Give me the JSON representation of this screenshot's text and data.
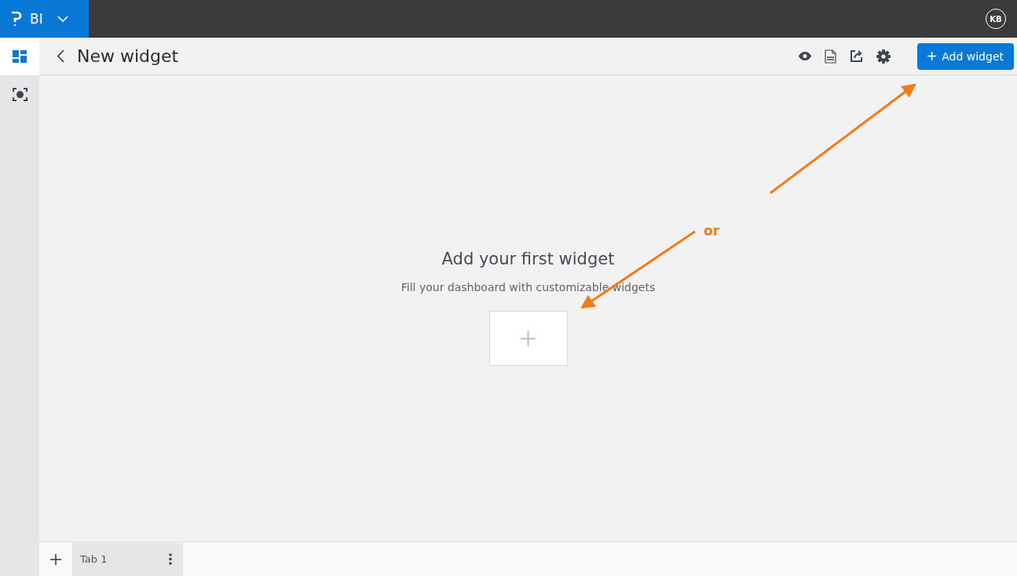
{
  "app": {
    "name": "BI",
    "user_initials": "KB"
  },
  "sidebar": {
    "items": [
      {
        "kind": "dashboard",
        "selected": true
      },
      {
        "kind": "focus",
        "selected": false
      }
    ]
  },
  "header": {
    "title": "New widget",
    "add_button": "Add widget"
  },
  "empty_state": {
    "title": "Add your first widget",
    "subtitle": "Fill your dashboard with customizable widgets"
  },
  "annotation": {
    "label": "or"
  },
  "tabs": [
    {
      "label": "Tab 1",
      "selected": true
    }
  ]
}
